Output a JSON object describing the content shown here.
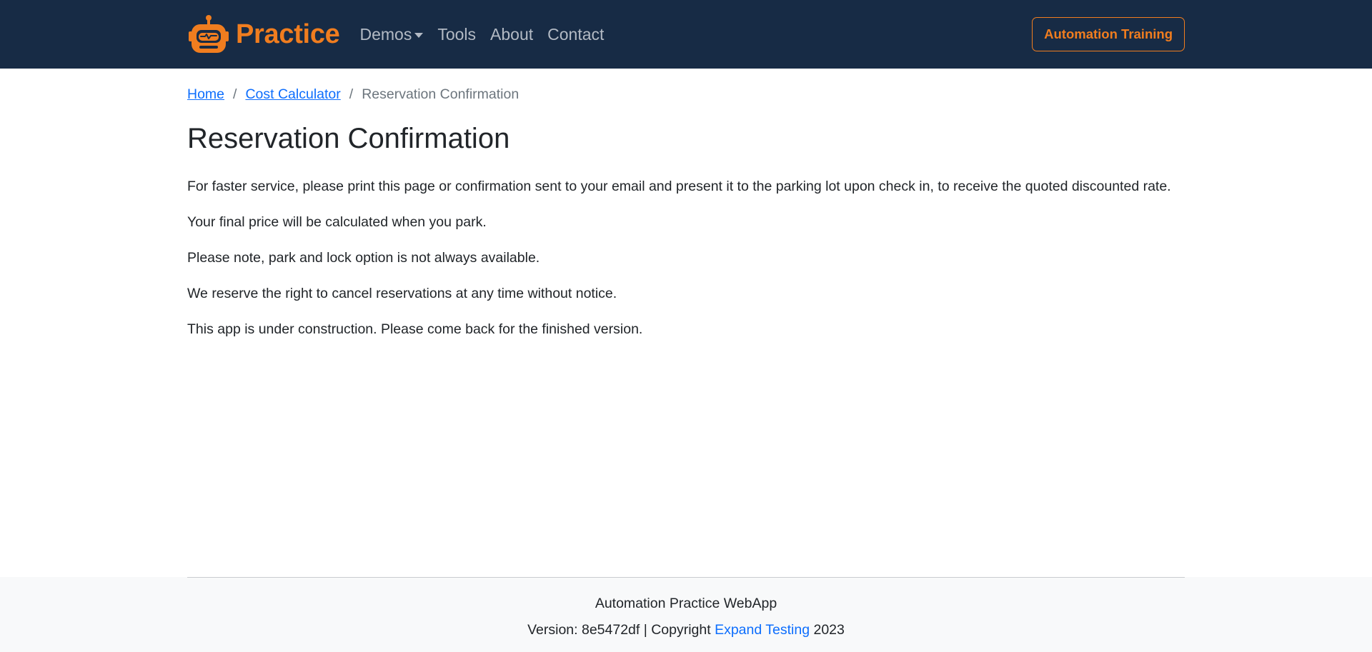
{
  "navbar": {
    "brand": "Practice",
    "links": [
      {
        "label": "Demos",
        "has_dropdown": true
      },
      {
        "label": "Tools"
      },
      {
        "label": "About"
      },
      {
        "label": "Contact"
      }
    ],
    "cta_label": "Automation Training"
  },
  "breadcrumb": {
    "home": "Home",
    "sep": "/",
    "calculator": "Cost Calculator",
    "current": "Reservation Confirmation"
  },
  "page": {
    "title": "Reservation Confirmation",
    "paragraphs": [
      "For faster service, please print this page or confirmation sent to your email and present it to the parking lot upon check in, to receive the quoted discounted rate.",
      "Your final price will be calculated when you park.",
      "Please note, park and lock option is not always available.",
      "We reserve the right to cancel reservations at any time without notice.",
      "This app is under construction. Please come back for the finished version."
    ]
  },
  "footer": {
    "app_name": "Automation Practice WebApp",
    "version_prefix": "Version: 8e5472df | Copyright ",
    "company": "Expand Testing",
    "year": " 2023"
  },
  "colors": {
    "navbar_bg": "#172b45",
    "accent": "#f07d1f",
    "link": "#0d6efd",
    "footer_bg": "#f8f9fa"
  }
}
